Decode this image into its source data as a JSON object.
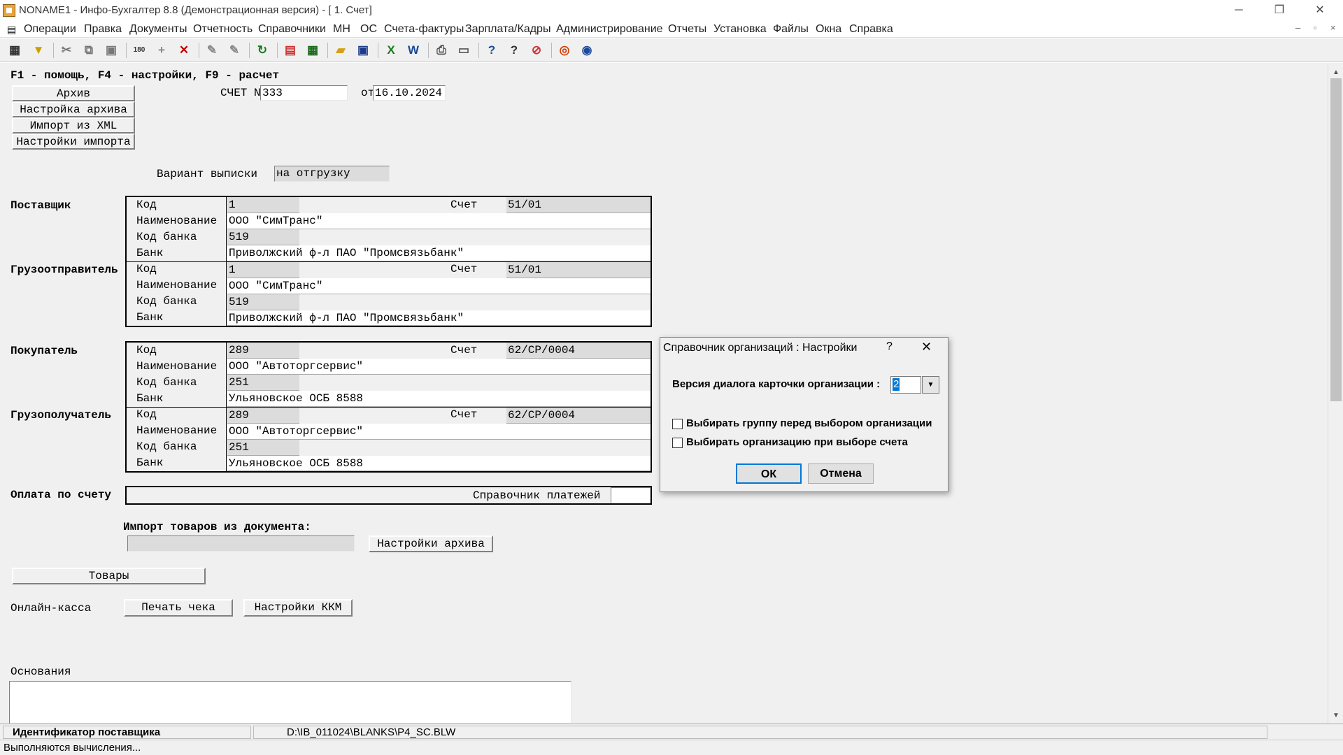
{
  "window": {
    "title": "NONAME1 - Инфо-Бухгалтер 8.8 (Демонстрационная версия) - [  1. Счет]",
    "minimize": "─",
    "restore": "❐",
    "close": "✕"
  },
  "menu": [
    "Операции",
    "Правка",
    "Документы",
    "Отчетность",
    "Справочники",
    "МН",
    "ОС",
    "Счета-фактуры",
    "Зарплата/Кадры",
    "Администрирование",
    "Отчеты",
    "Установка",
    "Файлы",
    "Окна",
    "Справка"
  ],
  "hint": "F1 - помощь, F4 - настройки, F9 - расчет",
  "side_buttons": [
    "Архив",
    "Настройка архива",
    "Импорт из XML",
    "Настройки импорта"
  ],
  "invoice": {
    "number_label": "СЧЕТ N",
    "number": "333",
    "date_label": "от",
    "date": "16.10.2024"
  },
  "variant": {
    "label": "Вариант выписки",
    "value": "на отгрузку"
  },
  "parties": [
    {
      "title": "Поставщик",
      "code_label": "Код",
      "code": "1",
      "account_label": "Счет",
      "account": "51/01",
      "name_label": "Наименование",
      "name": "ООО \"СимТранс\"",
      "bank_code_label": "Код банка",
      "bank_code": "519",
      "bank_label": "Банк",
      "bank": "Приволжский ф-л ПАО \"Промсвязьбанк\""
    },
    {
      "title": "Грузоотправитель",
      "code_label": "Код",
      "code": "1",
      "account_label": "Счет",
      "account": "51/01",
      "name_label": "Наименование",
      "name": "ООО \"СимТранс\"",
      "bank_code_label": "Код банка",
      "bank_code": "519",
      "bank_label": "Банк",
      "bank": "Приволжский ф-л ПАО \"Промсвязьбанк\""
    },
    {
      "title": "Покупатель",
      "code_label": "Код",
      "code": "289",
      "account_label": "Счет",
      "account": "62/СР/0004",
      "name_label": "Наименование",
      "name": "ООО \"Автоторгсервис\"",
      "bank_code_label": "Код банка",
      "bank_code": "251",
      "bank_label": "Банк",
      "bank": "Ульяновское ОСБ 8588"
    },
    {
      "title": "Грузополучатель",
      "code_label": "Код",
      "code": "289",
      "account_label": "Счет",
      "account": "62/СР/0004",
      "name_label": "Наименование",
      "name": "ООО \"Автоторгсервис\"",
      "bank_code_label": "Код банка",
      "bank_code": "251",
      "bank_label": "Банк",
      "bank": "Ульяновское ОСБ 8588"
    }
  ],
  "payment": {
    "label": "Оплата по счету",
    "directory": "Справочник платежей"
  },
  "import_goods": {
    "label": "Импорт товаров из документа:",
    "settings_button": "Настройки архива"
  },
  "goods_button": "Товары",
  "online_kassa": {
    "label": "Онлайн-касса",
    "print_button": "Печать чека",
    "kkm_button": "Настройки ККМ"
  },
  "basis": {
    "label": "Основания"
  },
  "status": {
    "field_name": "Идентификатор поставщика",
    "path": "D:\\IB_011024\\BLANKS\\P4_SC.BLW",
    "message": "Выполняются вычисления..."
  },
  "dialog": {
    "title": "Справочник организаций : Настройки",
    "help": "?",
    "close": "✕",
    "version_label": "Версия диалога карточки организации :",
    "version_value": "2",
    "option1": "Выбирать группу перед выбором организации",
    "option2": "Выбирать организацию при выборе счета",
    "ok": "ОК",
    "cancel": "Отмена"
  },
  "colors": {
    "workspace": "#f0f0f0",
    "dialog": "#f0f0f0",
    "selection": "#0078d7"
  }
}
